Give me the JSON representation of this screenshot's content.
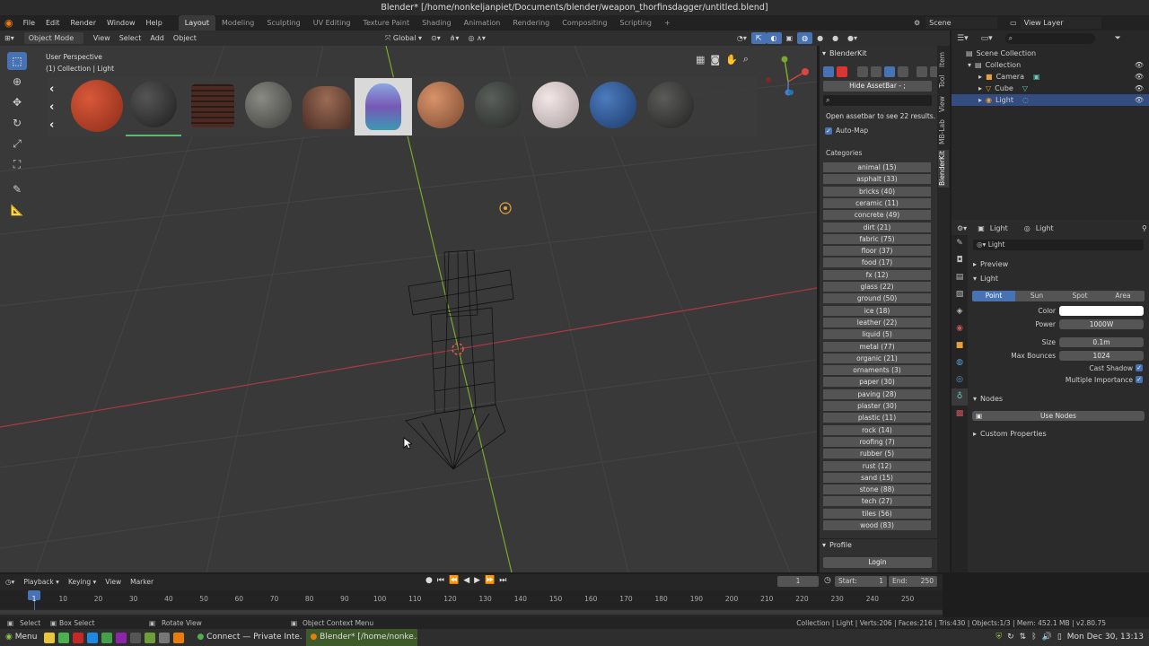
{
  "window": {
    "title": "Blender* [/home/nonkeljanpiet/Documents/blender/weapon_thorfinsdagger/untitled.blend]"
  },
  "topbar": {
    "menus": [
      "File",
      "Edit",
      "Render",
      "Window",
      "Help"
    ],
    "workspaces": [
      "Layout",
      "Modeling",
      "Sculpting",
      "UV Editing",
      "Texture Paint",
      "Shading",
      "Animation",
      "Rendering",
      "Compositing",
      "Scripting"
    ],
    "add_tab": "+",
    "scene": "Scene",
    "view_layer": "View Layer"
  },
  "viewport_header": {
    "mode": "Object Mode",
    "menus": [
      "View",
      "Select",
      "Add",
      "Object"
    ],
    "orientation": "Global"
  },
  "viewport": {
    "perspective": "User Perspective",
    "collection": "(1) Collection | Light"
  },
  "blenderkit": {
    "title": "BlenderKit",
    "hide_assetbar": "Hide AssetBar - ;",
    "search_placeholder": "",
    "results_text": "Open assetbar to see 22 results.",
    "automap": "Auto-Map",
    "categories_label": "Categories",
    "categories": [
      "animal (15)",
      "asphalt (33)",
      "bricks (40)",
      "ceramic (11)",
      "concrete (49)",
      "dirt (21)",
      "fabric (75)",
      "floor (37)",
      "food (17)",
      "fx (12)",
      "glass (22)",
      "ground (50)",
      "ice (18)",
      "leather (22)",
      "liquid (5)",
      "metal (77)",
      "organic (21)",
      "ornaments (3)",
      "paper (30)",
      "paving (28)",
      "plaster (30)",
      "plastic (11)",
      "rock (14)",
      "roofing (7)",
      "rubber (5)",
      "rust (12)",
      "sand (15)",
      "stone (88)",
      "tech (27)",
      "tiles (56)",
      "wood (83)"
    ],
    "profile": "Profile",
    "login": "Login"
  },
  "sidebar_tabs": [
    "Item",
    "Tool",
    "View",
    "MB-Lab",
    "BlenderKit"
  ],
  "outliner": {
    "root": "Scene Collection",
    "collection": "Collection",
    "items": [
      "Camera",
      "Cube",
      "Light"
    ]
  },
  "properties": {
    "breadcrumb_object": "Light",
    "breadcrumb_data": "Light",
    "datablock": "Light",
    "preview": "Preview",
    "light_section": "Light",
    "light_types": [
      "Point",
      "Sun",
      "Spot",
      "Area"
    ],
    "color_label": "Color",
    "power_label": "Power",
    "power_value": "1000W",
    "size_label": "Size",
    "size_value": "0.1m",
    "bounces_label": "Max Bounces",
    "bounces_value": "1024",
    "cast_shadow": "Cast Shadow",
    "multiple_importance": "Multiple Importance",
    "nodes": "Nodes",
    "use_nodes": "Use Nodes",
    "custom_props": "Custom Properties"
  },
  "timeline": {
    "menus": [
      "Playback",
      "Keying",
      "View",
      "Marker"
    ],
    "current_frame": "1",
    "start_label": "Start:",
    "start": "1",
    "end_label": "End:",
    "end": "250",
    "ticks": [
      "1",
      "10",
      "20",
      "30",
      "40",
      "50",
      "60",
      "70",
      "80",
      "90",
      "100",
      "110",
      "120",
      "130",
      "140",
      "150",
      "160",
      "170",
      "180",
      "190",
      "200",
      "210",
      "220",
      "230",
      "240",
      "250"
    ]
  },
  "statusbar": {
    "select": "Select",
    "box_select": "Box Select",
    "rotate": "Rotate View",
    "context": "Object Context Menu",
    "stats": "Collection | Light | Verts:206 | Faces:216 | Tris:430 | Objects:1/3 | Mem: 452.1 MB | v2.80.75"
  },
  "taskbar": {
    "menu": "Menu",
    "task1": "Connect — Private Inte...",
    "task2": "Blender* [/home/nonke...",
    "clock": "Mon Dec 30, 13:13"
  }
}
